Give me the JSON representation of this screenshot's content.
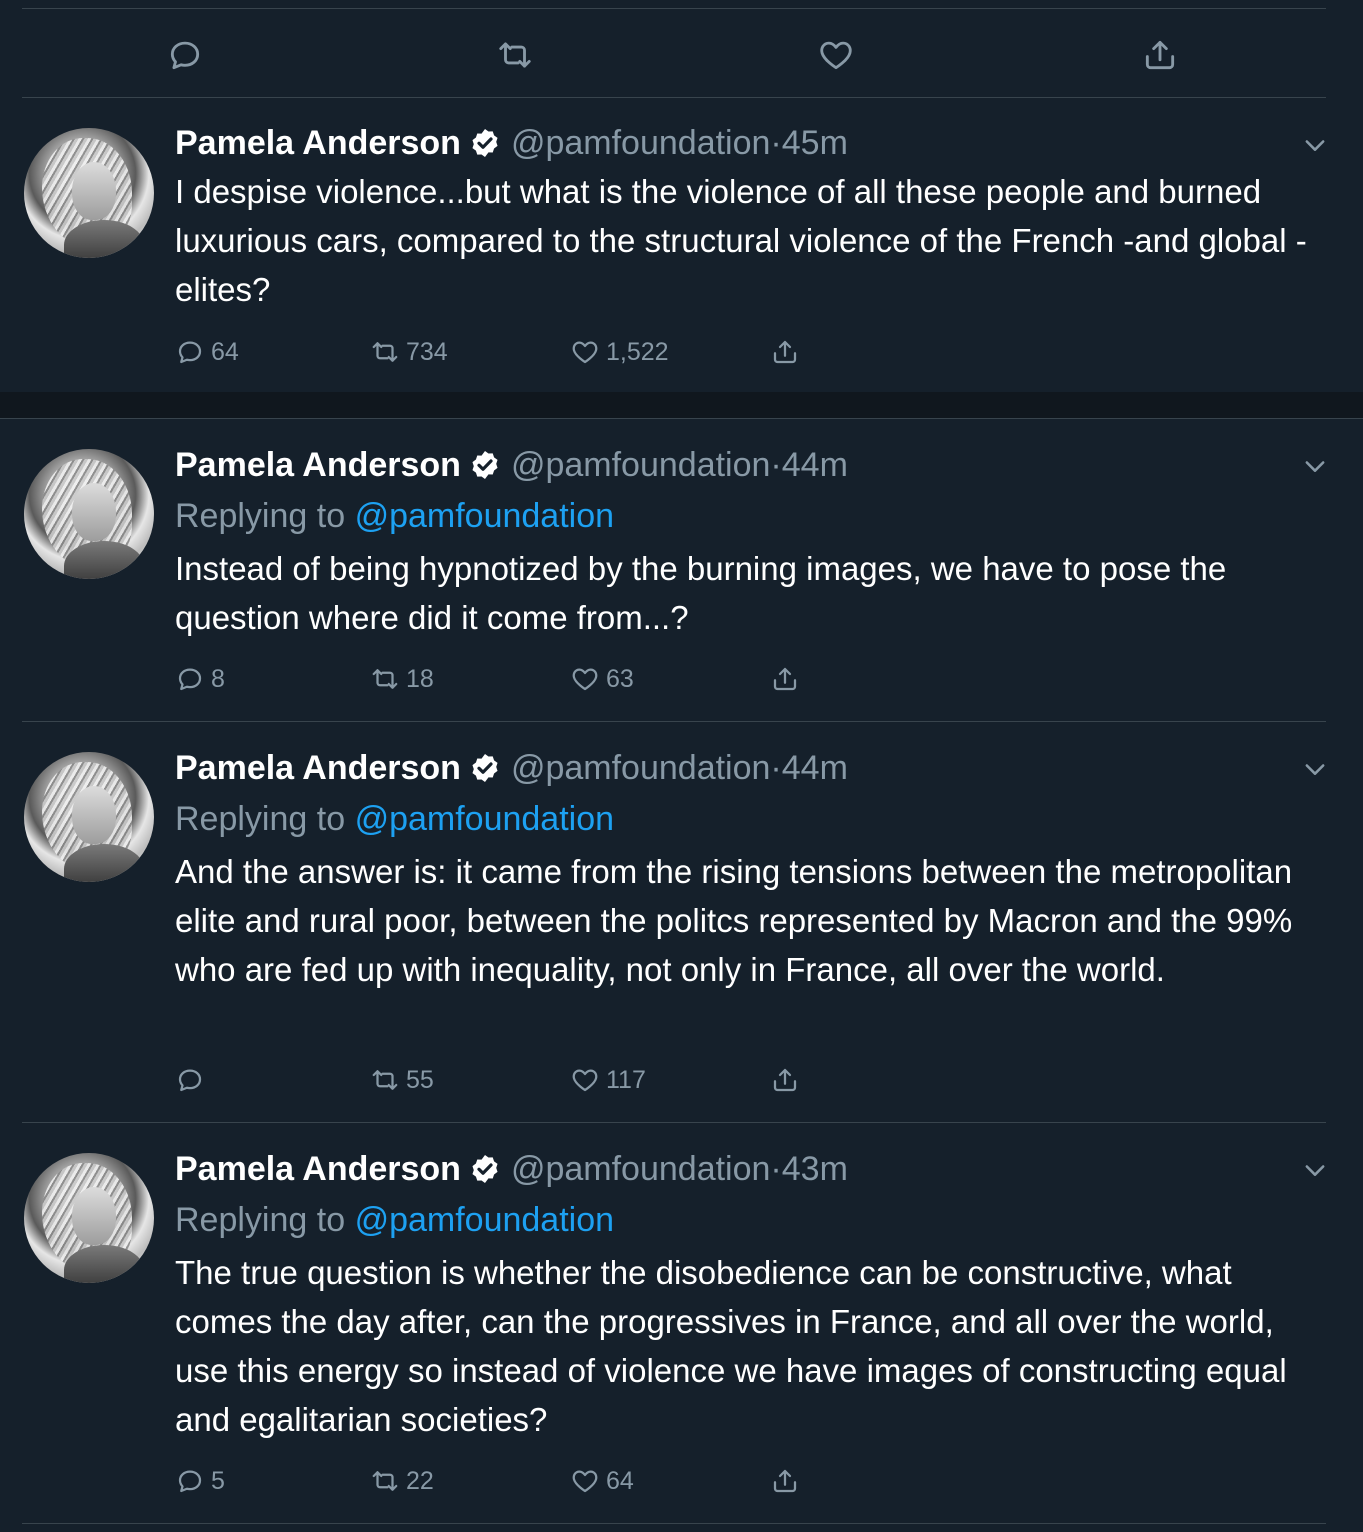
{
  "top_actions": {
    "reply_icon": "reply-icon",
    "retweet_icon": "retweet-icon",
    "like_icon": "heart-icon",
    "share_icon": "share-icon"
  },
  "tweets": [
    {
      "name": "Pamela Anderson",
      "handle": "@pamfoundation",
      "sep": "·",
      "time": "45m",
      "replying_prefix": "",
      "replying_to": "",
      "text": "I despise violence...but what is the violence of all these people and burned luxurious cars, compared to the structural violence of the French -and global - elites?",
      "replies": "64",
      "retweets": "734",
      "likes": "1,522"
    },
    {
      "name": "Pamela Anderson",
      "handle": "@pamfoundation",
      "sep": "·",
      "time": "44m",
      "replying_prefix": "Replying to",
      "replying_to": "@pamfoundation",
      "text": "Instead of being hypnotized by the burning images, we have to pose the question where did it come from...?",
      "replies": "8",
      "retweets": "18",
      "likes": "63"
    },
    {
      "name": "Pamela Anderson",
      "handle": "@pamfoundation",
      "sep": "·",
      "time": "44m",
      "replying_prefix": "Replying to",
      "replying_to": "@pamfoundation",
      "text": "And the answer is: it came from the rising tensions between the metropolitan elite and rural poor, between the politcs represented by Macron and the 99% who are fed up with inequality, not only in France, all over the world.",
      "replies": "",
      "retweets": "55",
      "likes": "117"
    },
    {
      "name": "Pamela Anderson",
      "handle": "@pamfoundation",
      "sep": "·",
      "time": "43m",
      "replying_prefix": "Replying to",
      "replying_to": "@pamfoundation",
      "text": "The true question is whether the disobedience can be constructive, what comes the day after, can the progressives in France, and all over the world, use this energy so instead of violence we have images of constructing equal and egalitarian societies?",
      "replies": "5",
      "retweets": "22",
      "likes": "64"
    }
  ],
  "colors": {
    "background": "#15202b",
    "separator_band": "#10171e",
    "divider": "#38444d",
    "secondary_text": "#8899a6",
    "link": "#1da1f2",
    "primary_text": "#ffffff"
  }
}
